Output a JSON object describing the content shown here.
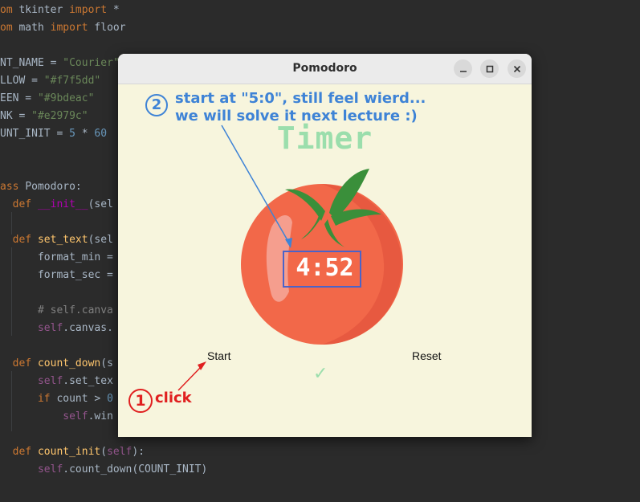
{
  "editor": {
    "lines": [
      [
        {
          "t": "om ",
          "c": "kw"
        },
        {
          "t": "tkinter ",
          "c": "plain"
        },
        {
          "t": "import ",
          "c": "kw"
        },
        {
          "t": "*",
          "c": "plain"
        }
      ],
      [
        {
          "t": "om ",
          "c": "kw"
        },
        {
          "t": "math ",
          "c": "plain"
        },
        {
          "t": "import ",
          "c": "kw"
        },
        {
          "t": "floor",
          "c": "plain"
        }
      ],
      [],
      [
        {
          "t": "NT_NAME = ",
          "c": "plain"
        },
        {
          "t": "\"Courier\"",
          "c": "str"
        }
      ],
      [
        {
          "t": "LLOW = ",
          "c": "plain"
        },
        {
          "t": "\"#f7f5dd\"",
          "c": "str"
        }
      ],
      [
        {
          "t": "EEN = ",
          "c": "plain"
        },
        {
          "t": "\"#9bdeac\"",
          "c": "str"
        }
      ],
      [
        {
          "t": "NK = ",
          "c": "plain"
        },
        {
          "t": "\"#e2979c\"",
          "c": "str"
        }
      ],
      [
        {
          "t": "UNT_INIT = ",
          "c": "plain"
        },
        {
          "t": "5",
          "c": "num"
        },
        {
          "t": " * ",
          "c": "plain"
        },
        {
          "t": "60",
          "c": "num"
        }
      ],
      [],
      [],
      [
        {
          "t": "ass ",
          "c": "kw"
        },
        {
          "t": "Pomodoro:",
          "c": "plain"
        }
      ],
      [
        {
          "t": "  ",
          "c": "plain"
        },
        {
          "t": "def ",
          "c": "kw"
        },
        {
          "t": "__init__",
          "c": "magic"
        },
        {
          "t": "(sel",
          "c": "plain"
        }
      ],
      [],
      [
        {
          "t": "  ",
          "c": "plain"
        },
        {
          "t": "def ",
          "c": "kw"
        },
        {
          "t": "set_text",
          "c": "fn"
        },
        {
          "t": "(sel",
          "c": "plain"
        }
      ],
      [
        {
          "t": "      format_min =",
          "c": "plain"
        }
      ],
      [
        {
          "t": "      format_sec =",
          "c": "plain"
        }
      ],
      [],
      [
        {
          "t": "      # self.canva",
          "c": "cm"
        }
      ],
      [
        {
          "t": "      ",
          "c": "plain"
        },
        {
          "t": "self",
          "c": "self"
        },
        {
          "t": ".canvas.",
          "c": "plain"
        }
      ],
      [],
      [
        {
          "t": "  ",
          "c": "plain"
        },
        {
          "t": "def ",
          "c": "kw"
        },
        {
          "t": "count_down",
          "c": "fn"
        },
        {
          "t": "(s",
          "c": "plain"
        }
      ],
      [
        {
          "t": "      ",
          "c": "plain"
        },
        {
          "t": "self",
          "c": "self"
        },
        {
          "t": ".set_tex",
          "c": "plain"
        }
      ],
      [
        {
          "t": "      ",
          "c": "plain"
        },
        {
          "t": "if ",
          "c": "kw"
        },
        {
          "t": "count > ",
          "c": "plain"
        },
        {
          "t": "0",
          "c": "num"
        }
      ],
      [
        {
          "t": "          ",
          "c": "plain"
        },
        {
          "t": "self",
          "c": "self"
        },
        {
          "t": ".win",
          "c": "plain"
        }
      ],
      [],
      [
        {
          "t": "  ",
          "c": "plain"
        },
        {
          "t": "def ",
          "c": "kw"
        },
        {
          "t": "count_init",
          "c": "fn"
        },
        {
          "t": "(",
          "c": "plain"
        },
        {
          "t": "self",
          "c": "self"
        },
        {
          "t": "):",
          "c": "plain"
        }
      ],
      [
        {
          "t": "      ",
          "c": "plain"
        },
        {
          "t": "self",
          "c": "self"
        },
        {
          "t": ".count_down(COUNT_INIT)",
          "c": "plain"
        }
      ]
    ]
  },
  "window": {
    "title": "Pomodoro",
    "controls": [
      "minimize-icon",
      "maximize-icon",
      "close-icon"
    ]
  },
  "app": {
    "timer_label": "Timer",
    "time_display": "4:52",
    "start_label": "Start",
    "reset_label": "Reset",
    "check_marks": "✓"
  },
  "annotations": {
    "note2_number": "2",
    "note2_line1": "start at \"5:0\", still feel wierd...",
    "note2_line2": "we will solve it next lecture :)",
    "note1_number": "1",
    "note1_text": "click"
  },
  "colors": {
    "yellow_bg": "#f7f5dd",
    "green": "#9bdeac",
    "annotation_blue": "#3e83d6",
    "annotation_red": "#e02020"
  }
}
